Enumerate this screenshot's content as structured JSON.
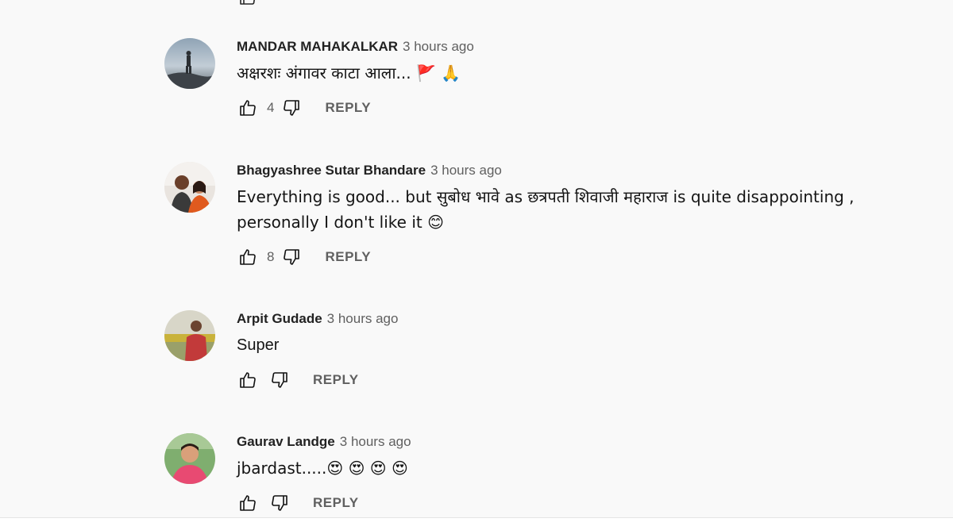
{
  "colors": {
    "background": "#f9f9f9",
    "author": "#222222",
    "meta": "#606060"
  },
  "comments": [
    {
      "author": "MANDAR MAHAKALKAR",
      "time": "3 hours ago",
      "text_lines": [
        "अक्षरशः अंगावर काटा आला... 🚩 🙏"
      ],
      "likes": "4",
      "reply_label": "REPLY"
    },
    {
      "author": "Bhagyashree Sutar Bhandare",
      "time": "3 hours ago",
      "text_lines": [
        "Everything is good... but सुबोध भावे as छत्रपती शिवाजी महाराज is quite disappointing ,",
        "personally I don't like it 😊"
      ],
      "likes": "8",
      "reply_label": "REPLY"
    },
    {
      "author": "Arpit Gudade",
      "time": "3 hours ago",
      "text_lines": [
        "Super"
      ],
      "likes": "",
      "reply_label": "REPLY"
    },
    {
      "author": "Gaurav Landge",
      "time": "3 hours ago",
      "text_lines": [
        "jbardast.....😍 😍 😍 😍"
      ],
      "likes": "",
      "reply_label": "REPLY"
    }
  ],
  "icons": {
    "like": "thumb-up-icon",
    "dislike": "thumb-down-icon"
  }
}
